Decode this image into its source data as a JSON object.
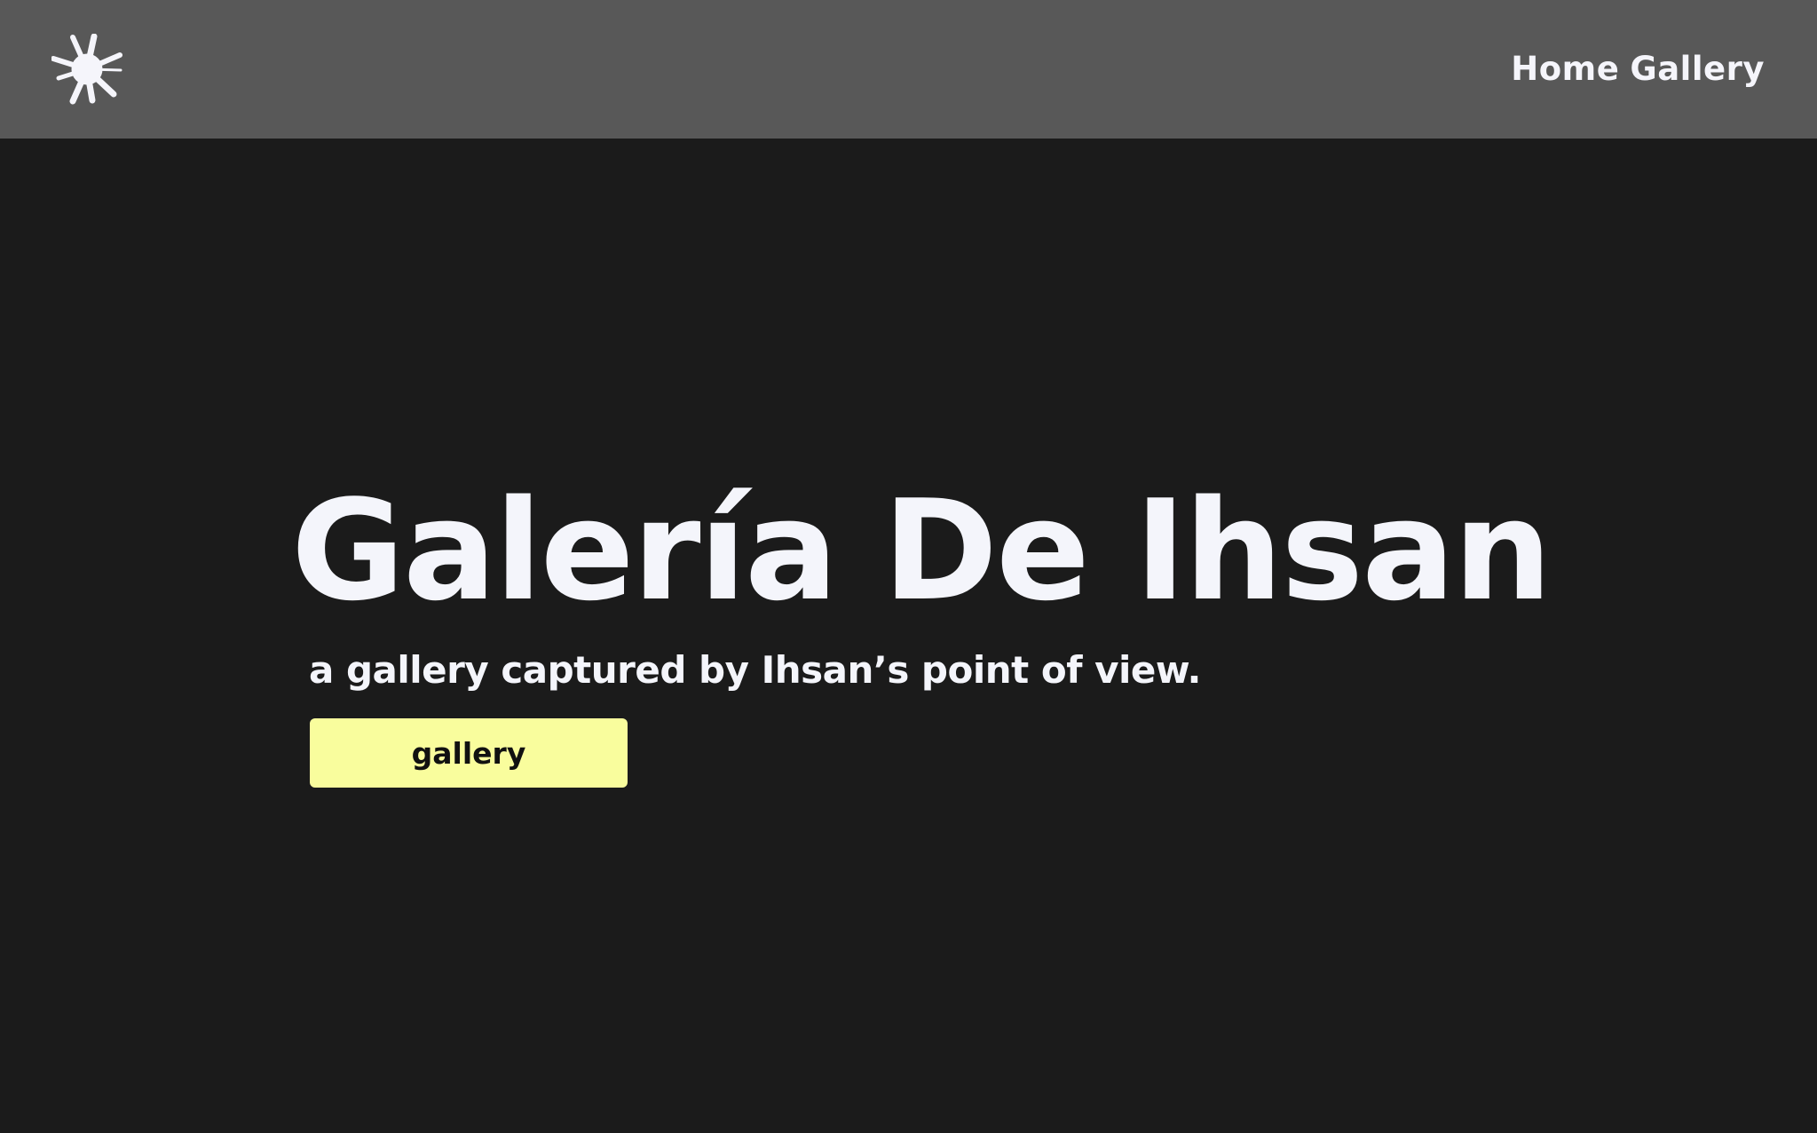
{
  "header": {
    "logo_icon": "starburst-icon",
    "nav": [
      {
        "label": "Home"
      },
      {
        "label": "Gallery"
      }
    ]
  },
  "hero": {
    "title": "Galería De Ihsan",
    "subtitle": "a gallery captured by Ihsan’s point of view.",
    "button_label": "gallery"
  },
  "colors": {
    "header_bg": "#585858",
    "page_bg": "#1b1b1b",
    "text": "#f4f5fb",
    "button_bg": "#f9fd9d",
    "button_text": "#111111"
  }
}
